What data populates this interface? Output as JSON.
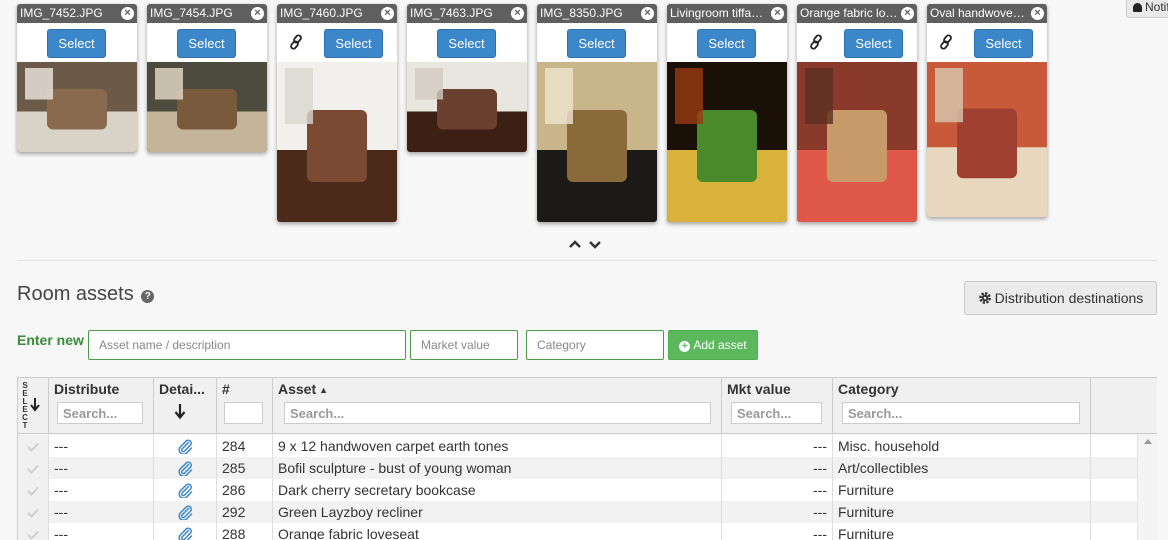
{
  "notifications_label": "Notifications",
  "cards": [
    {
      "name": "IMG_7452.JPG",
      "select": "Select",
      "linked": false,
      "colors": [
        "#6b5a48",
        "#d9d2c7",
        "#8a6a4f",
        "#efe9e1"
      ]
    },
    {
      "name": "IMG_7454.JPG",
      "select": "Select",
      "linked": false,
      "colors": [
        "#4d4a3e",
        "#c4b49a",
        "#7a5a3c",
        "#e7dccb"
      ]
    },
    {
      "name": "IMG_7460.JPG",
      "select": "Select",
      "linked": true,
      "colors": [
        "#f2f0ec",
        "#4c2a1a",
        "#7a4a32",
        "#d9d6d0"
      ]
    },
    {
      "name": "IMG_7463.JPG",
      "select": "Select",
      "linked": false,
      "colors": [
        "#e9e6df",
        "#3c2014",
        "#6a4030",
        "#d2ccc2"
      ]
    },
    {
      "name": "IMG_8350.JPG",
      "select": "Select",
      "linked": false,
      "colors": [
        "#c9b58a",
        "#1c1a16",
        "#8a6a3a",
        "#efe5cf"
      ]
    },
    {
      "name": "Livingroom tiffany lamp",
      "select": "Select",
      "linked": false,
      "colors": [
        "#1a1006",
        "#d8b23a",
        "#4a8a2a",
        "#9a3a10"
      ]
    },
    {
      "name": "Orange fabric loveseat",
      "select": "Select",
      "linked": true,
      "colors": [
        "#8a3a2a",
        "#e0584a",
        "#c89a6a",
        "#5a3020"
      ]
    },
    {
      "name": "Oval handwoven rug",
      "select": "Select",
      "linked": true,
      "colors": [
        "#c85a3a",
        "#e8d8c0",
        "#a04030",
        "#d9c8b0"
      ]
    }
  ],
  "section": {
    "title": "Room assets",
    "help": "?"
  },
  "distribution_button": "Distribution destinations",
  "enter_new": {
    "label": "Enter new",
    "name_placeholder": "Asset name / description",
    "value_placeholder": "Market value",
    "category_placeholder": "Category",
    "add_label": "Add asset"
  },
  "grid": {
    "select_header": "SELECT",
    "columns": {
      "distribute": "Distribute",
      "details": "Detai...",
      "number": "#",
      "asset": "Asset",
      "mkt_value": "Mkt value",
      "category": "Category"
    },
    "search_placeholder": "Search...",
    "rows": [
      {
        "distribute": "---",
        "number": "284",
        "asset": "9 x 12 handwoven carpet earth tones",
        "mkt_value": "---",
        "category": "Misc. household"
      },
      {
        "distribute": "---",
        "number": "285",
        "asset": "Bofil sculpture - bust of young woman",
        "mkt_value": "---",
        "category": "Art/collectibles"
      },
      {
        "distribute": "---",
        "number": "286",
        "asset": "Dark cherry secretary bookcase",
        "mkt_value": "---",
        "category": "Furniture"
      },
      {
        "distribute": "---",
        "number": "292",
        "asset": "Green Layzboy recliner",
        "mkt_value": "---",
        "category": "Furniture"
      },
      {
        "distribute": "---",
        "number": "288",
        "asset": "Orange fabric loveseat",
        "mkt_value": "---",
        "category": "Furniture"
      }
    ]
  }
}
